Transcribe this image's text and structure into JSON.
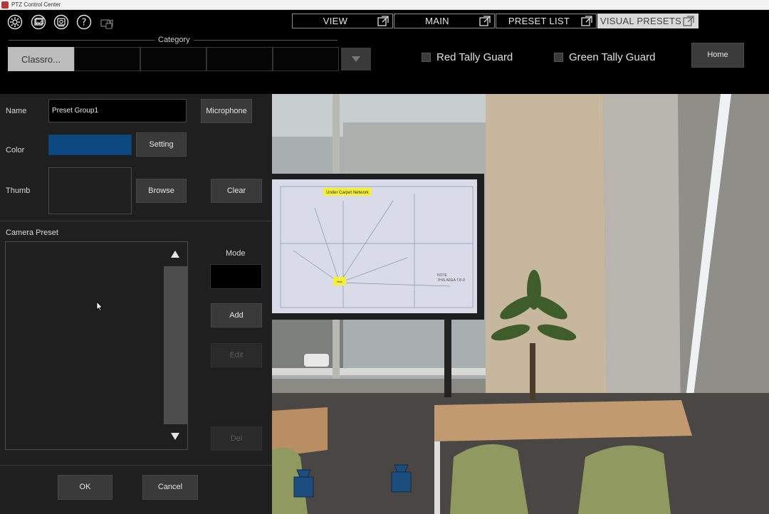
{
  "window": {
    "title": "PTZ Control Center"
  },
  "toolbar": {
    "icons": [
      "settings-icon",
      "gallery-icon",
      "camera-control-icon",
      "help-icon",
      "camera-lock-icon"
    ],
    "tabs": [
      {
        "label": "VIEW",
        "active": false
      },
      {
        "label": "MAIN",
        "active": false
      },
      {
        "label": "PRESET LIST",
        "active": false
      },
      {
        "label": "VISUAL PRESETS",
        "active": true
      }
    ]
  },
  "category": {
    "title": "Category",
    "selected": "Classro...",
    "cells": [
      "Classro...",
      "",
      "",
      "",
      ""
    ]
  },
  "tally": {
    "red_label": "Red Tally Guard",
    "red_checked": false,
    "green_label": "Green Tally Guard",
    "green_checked": false
  },
  "home_label": "Home",
  "form": {
    "name_label": "Name",
    "name_value": "Preset Group1",
    "microphone_label": "Microphone",
    "color_label": "Color",
    "color_value": "#0b4880",
    "setting_label": "Setting",
    "thumb_label": "Thumb",
    "browse_label": "Browse",
    "clear_label": "Clear",
    "camera_preset_label": "Camera Preset",
    "mode_label": "Mode",
    "add_label": "Add",
    "edit_label": "Edit",
    "del_label": "Del",
    "ok_label": "OK",
    "cancel_label": "Cancel"
  },
  "camera_view": {
    "screen_banner": "Under Carpet Network",
    "note_line1": "NOTE",
    "note_line2": "THIS AREA T.B.D",
    "hub_label": "Hub"
  },
  "colors": {
    "accent_blue": "#0b4880",
    "panel_bg": "#1f1f1f",
    "active_tab": "#d9d9d9"
  }
}
